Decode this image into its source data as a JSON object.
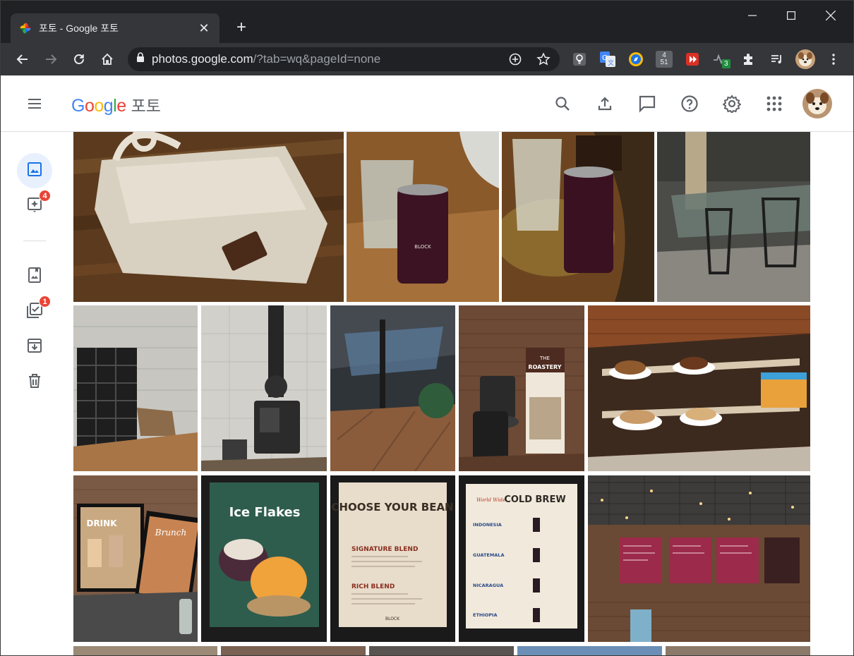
{
  "browser": {
    "tab_title": "포토 - Google 포토",
    "url_host": "photos.google.com",
    "url_path": "/?tab=wq&pageId=none",
    "extension_badge": "3",
    "calendar_ext": {
      "top": "4",
      "bottom": "51"
    }
  },
  "app": {
    "logo_google": [
      "G",
      "o",
      "o",
      "g",
      "l",
      "e"
    ],
    "logo_colors": [
      "#4285F4",
      "#EA4335",
      "#FBBC05",
      "#4285F4",
      "#34A853",
      "#EA4335"
    ],
    "logo_product": "포토",
    "header_icons": [
      "search-icon",
      "upload-icon",
      "feedback-icon",
      "help-icon",
      "settings-icon",
      "apps-icon",
      "avatar"
    ]
  },
  "sidenav": {
    "items": [
      {
        "name": "photos",
        "icon": "photo-icon",
        "badge": ""
      },
      {
        "name": "for-you",
        "icon": "sparkle-icon",
        "badge": "4"
      },
      {
        "name": "albums",
        "icon": "album-icon",
        "badge": ""
      },
      {
        "name": "utilities",
        "icon": "checklist-icon",
        "badge": "1"
      },
      {
        "name": "archive",
        "icon": "archive-icon",
        "badge": ""
      },
      {
        "name": "trash",
        "icon": "trash-icon",
        "badge": ""
      }
    ]
  },
  "photos": {
    "row1": [
      "crochet-bag",
      "cold-brew-can",
      "cold-brew-can-table",
      "cafe-patio-tables"
    ],
    "row2": [
      "shelf-room",
      "wood-stove",
      "atrium-interior",
      "roastery-banner",
      "pastry-case"
    ],
    "row3": [
      "drink-brunch-posters",
      "ice-flakes-poster",
      "choose-your-bean-menu",
      "cold-brew-menu",
      "menu-boards"
    ]
  },
  "poster_text": {
    "choose_title": "CHOOSE YOUR BEAN",
    "choose_blend1": "SIGNATURE BLEND",
    "choose_blend2": "RICH BLEND",
    "cold_brew_title": "COLD BREW",
    "cold_brew_prefix": "World Wide",
    "cold_brew_origins": [
      "INDONESIA",
      "GUATEMALA",
      "NICARAGUA",
      "ETHIOPIA"
    ],
    "ice_flakes": "Ice Flakes",
    "drink": "DRINK",
    "brunch": "Brunch",
    "roastery_the": "THE",
    "roastery": "ROASTERY",
    "block": "BLOCK"
  },
  "colors": {
    "chrome_dark": "#202124",
    "chrome_tab": "#35363a",
    "nav_active": "#e8f0fe",
    "badge": "#ea4335",
    "icon_gray": "#5f6368"
  }
}
